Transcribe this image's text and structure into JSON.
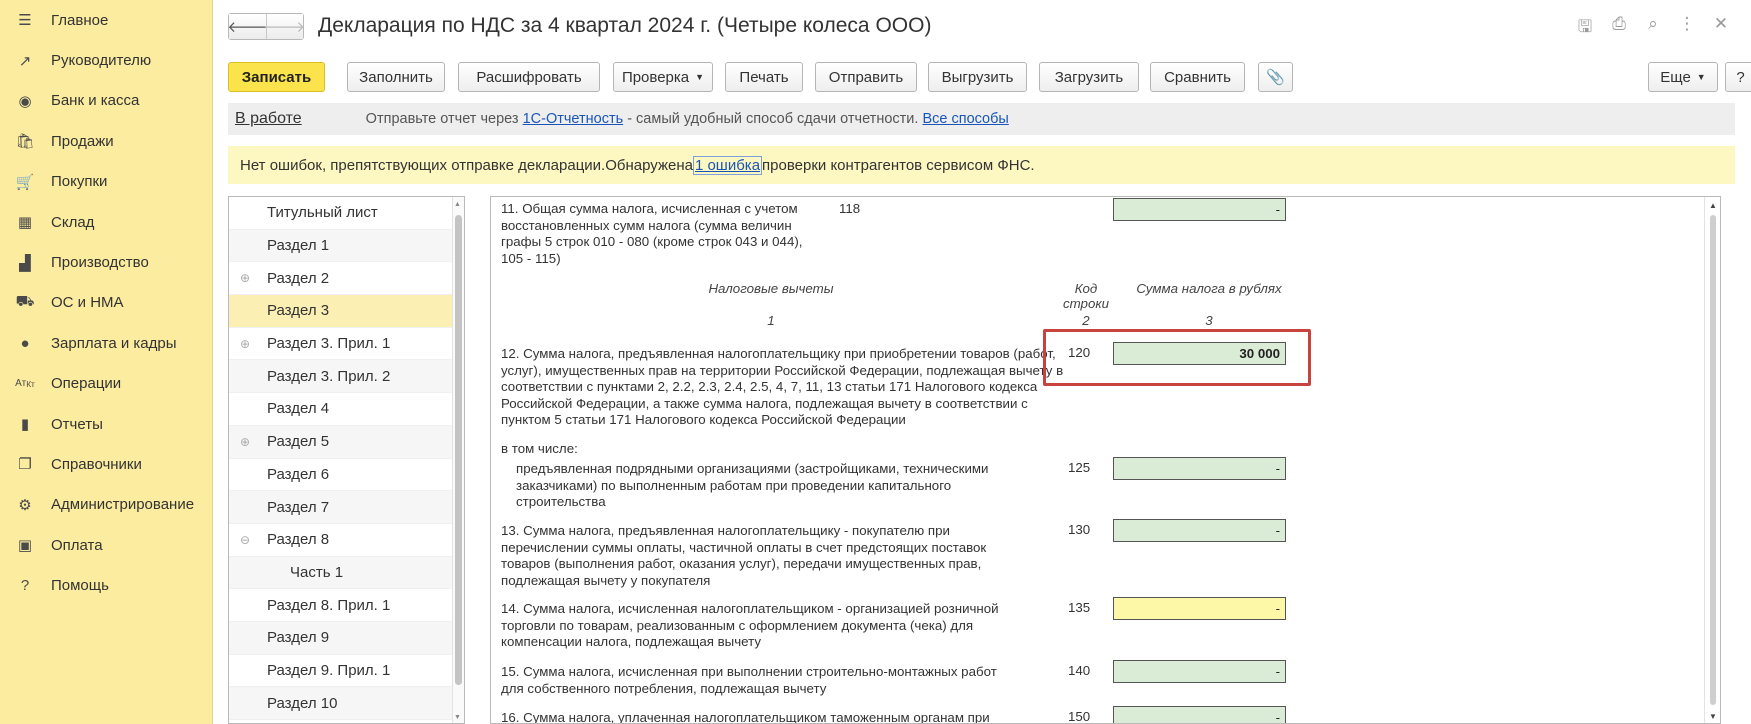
{
  "nav": {
    "items": [
      {
        "label": "Главное",
        "icon": "hamburger-icon"
      },
      {
        "label": "Руководителю",
        "icon": "trend-chart-icon"
      },
      {
        "label": "Банк и касса",
        "icon": "coins-icon"
      },
      {
        "label": "Продажи",
        "icon": "shopping-bag-icon"
      },
      {
        "label": "Покупки",
        "icon": "cart-icon"
      },
      {
        "label": "Склад",
        "icon": "warehouse-icon"
      },
      {
        "label": "Производство",
        "icon": "factory-icon"
      },
      {
        "label": "ОС и НМА",
        "icon": "truck-icon"
      },
      {
        "label": "Зарплата и кадры",
        "icon": "person-icon"
      },
      {
        "label": "Операции",
        "icon": "operations-icon"
      },
      {
        "label": "Отчеты",
        "icon": "bar-chart-icon"
      },
      {
        "label": "Справочники",
        "icon": "books-icon"
      },
      {
        "label": "Администрирование",
        "icon": "gear-icon"
      },
      {
        "label": "Оплата",
        "icon": "wallet-icon"
      },
      {
        "label": "Помощь",
        "icon": "question-icon"
      }
    ]
  },
  "window": {
    "title": "Декларация по НДС за 4 квартал 2024 г. (Четыре колеса ООО)",
    "back": "🡐",
    "forward": "🡒"
  },
  "toolbar": {
    "save": "Записать",
    "fill": "Заполнить",
    "decode": "Расшифровать",
    "check": "Проверка",
    "print": "Печать",
    "send": "Отправить",
    "export": "Выгрузить",
    "import": "Загрузить",
    "compare": "Сравнить",
    "more": "Еще",
    "help": "?"
  },
  "status": {
    "state": "В работе",
    "msg_prefix": "Отправьте отчет через ",
    "msg_link": "1С-Отчетность",
    "msg_middle": " - самый удобный способ сдачи отчетности. ",
    "msg_link2": "Все способы"
  },
  "notice": {
    "prefix": "Нет ошибок, препятствующих отправке декларации.Обнаружена ",
    "link": "1 ошибка",
    "suffix": " проверки контрагентов сервисом ФНС."
  },
  "tree": {
    "items": [
      {
        "label": "Титульный лист",
        "expand": ""
      },
      {
        "label": "Раздел 1",
        "expand": ""
      },
      {
        "label": "Раздел 2",
        "expand": "⊕"
      },
      {
        "label": "Раздел 3",
        "expand": ""
      },
      {
        "label": "Раздел 3. Прил. 1",
        "expand": "⊕"
      },
      {
        "label": "Раздел 3. Прил. 2",
        "expand": ""
      },
      {
        "label": "Раздел 4",
        "expand": ""
      },
      {
        "label": "Раздел 5",
        "expand": "⊕"
      },
      {
        "label": "Раздел 6",
        "expand": ""
      },
      {
        "label": "Раздел 7",
        "expand": ""
      },
      {
        "label": "Раздел 8",
        "expand": "⊖"
      },
      {
        "label": "Часть 1",
        "expand": ""
      },
      {
        "label": "Раздел 8. Прил. 1",
        "expand": ""
      },
      {
        "label": "Раздел 9",
        "expand": ""
      },
      {
        "label": "Раздел 9. Прил. 1",
        "expand": ""
      },
      {
        "label": "Раздел 10",
        "expand": ""
      }
    ]
  },
  "form": {
    "row11": {
      "text": "11. Общая сумма налога, исчисленная с учетом восстановленных сумм налога (сумма величин графы 5 строк 010 - 080 (кроме строк 043 и 044), 105 - 115)",
      "code": "118",
      "value": "-"
    },
    "header": {
      "col1": "Налоговые вычеты",
      "col2": "Код строки",
      "col3": "Сумма налога в рублях",
      "n1": "1",
      "n2": "2",
      "n3": "3"
    },
    "row12": {
      "text": "12. Сумма налога, предъявленная налогоплательщику при приобретении товаров (работ, услуг), имущественных прав на территории Российской Федерации, подлежащая вычету в соответствии с пунктами 2, 2.2, 2.3, 2.4, 2.5, 4, 7, 11, 13 статьи 171 Налогового кодекса Российской Федерации, а также сумма налога, подлежащая вычету в соответствии с пунктом 5 статьи 171 Налогового кодекса Российской Федерации",
      "code": "120",
      "value": "30 000"
    },
    "including": "в том числе:",
    "row125": {
      "text": "предъявленная подрядными организациями (застройщиками, техническими заказчиками) по выполненным работам при проведении капитального строительства",
      "code": "125",
      "value": "-"
    },
    "row13": {
      "text": "13. Сумма налога, предъявленная налогоплательщику - покупателю при перечислении суммы оплаты, частичной оплаты в счет предстоящих поставок товаров (выполнения работ, оказания услуг), передачи имущественных прав, подлежащая вычету у покупателя",
      "code": "130",
      "value": "-"
    },
    "row14": {
      "text": "14. Сумма налога, исчисленная налогоплательщиком - организацией розничной торговли по товарам, реализованным с оформлением документа (чека) для компенсации налога, подлежащая вычету",
      "code": "135",
      "value": "-"
    },
    "row15": {
      "text": "15. Сумма налога, исчисленная при выполнении строительно-монтажных работ для собственного потребления, подлежащая вычету",
      "code": "140",
      "value": "-"
    },
    "row16": {
      "text": "16. Сумма налога, уплаченная налогоплательщиком таможенным органам при",
      "code": "150",
      "value": "-"
    }
  }
}
